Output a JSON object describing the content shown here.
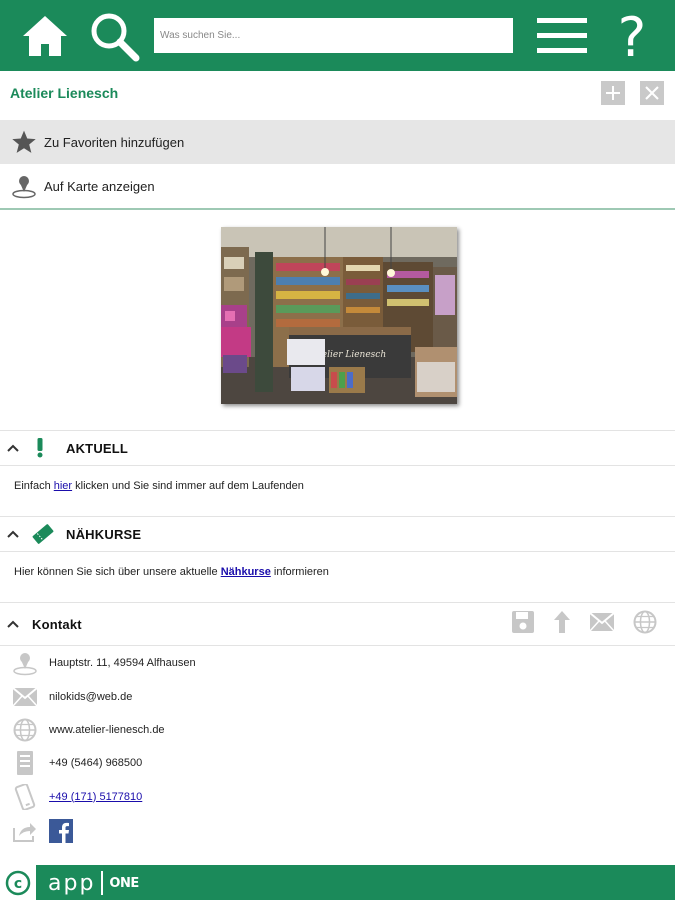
{
  "topbar": {
    "search_placeholder": "Was suchen Sie...",
    "icons": [
      "home-icon",
      "search-icon",
      "menu-icon",
      "help-icon"
    ],
    "accent_color": "#1b8a5a"
  },
  "titlebar": {
    "title": "Atelier Lienesch"
  },
  "actions": {
    "favorite_label": "Zu Favoriten hinzufügen",
    "map_label": "Auf Karte anzeigen"
  },
  "aktuell": {
    "title": "AKTUELL",
    "text_before": "Einfach ",
    "link": "hier",
    "text_after": " klicken und Sie sind immer auf dem Laufenden"
  },
  "naehkurse": {
    "title": "NÄHKURSE",
    "text_before": "Hier können Sie sich über unsere aktuelle ",
    "link": "Nähkurse",
    "text_after": " informieren"
  },
  "kontakt": {
    "title": "Kontakt",
    "address": "Hauptstr. 11, 49594 Alfhausen",
    "email": "nilokids@web.de",
    "website": "www.atelier-lienesch.de",
    "phone": "+49 (5464) 968500",
    "mobile": "+49 (171) 5177810"
  },
  "photo": {
    "sign_text": "Atelier Lienesch"
  },
  "footer": {
    "brand_app": "app",
    "brand_one": "ONE",
    "copyright_symbol": "©"
  }
}
